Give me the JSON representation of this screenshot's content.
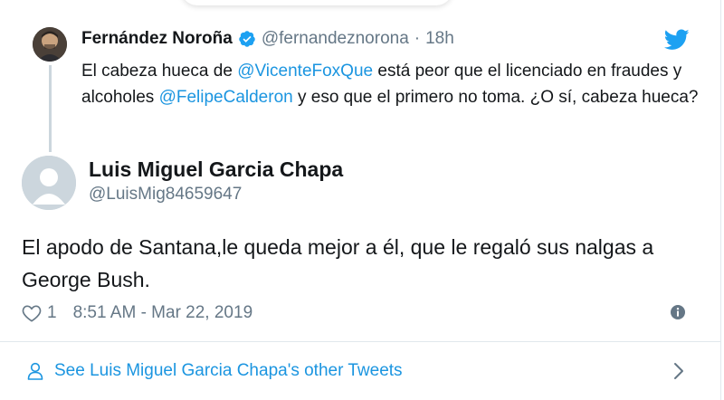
{
  "quoted_tweet": {
    "author_name": "Fernández Noroña",
    "handle": "@fernandeznorona",
    "separator": "·",
    "age": "18h",
    "text_parts": [
      {
        "text": "El cabeza hueca de ",
        "mention": false
      },
      {
        "text": "@VicenteFoxQue",
        "mention": true
      },
      {
        "text": " está peor que el licenciado en fraudes y alcoholes ",
        "mention": false
      },
      {
        "text": "@FelipeCalderon",
        "mention": true
      },
      {
        "text": " y eso que el primero no toma. ¿O sí, cabeza hueca?",
        "mention": false
      }
    ]
  },
  "reply_tweet": {
    "author_name": "Luis Miguel Garcia Chapa",
    "handle": "@LuisMig84659647",
    "text": "El apodo de Santana,le queda mejor a él, que le regaló sus nalgas a George Bush.",
    "like_count": "1",
    "timestamp": "8:51 AM - Mar 22, 2019"
  },
  "footer": {
    "link_text": "See Luis Miguel Garcia Chapa's other Tweets"
  },
  "icons": {
    "verified": "verified-badge-icon",
    "brand": "twitter-bird-icon",
    "like": "heart-icon",
    "info": "info-icon",
    "profile": "person-icon",
    "chevron": "chevron-right-icon"
  },
  "colors": {
    "link": "#1b95e0",
    "muted": "#657786",
    "text": "#14171a",
    "border": "#e1e8ed"
  }
}
